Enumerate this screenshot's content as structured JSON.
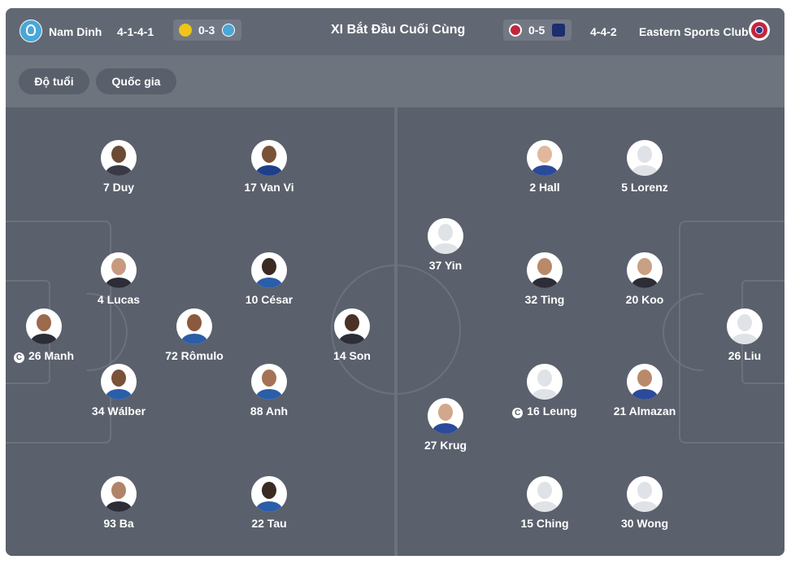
{
  "header": {
    "title": "XI Bắt Đầu Cuối Cùng",
    "home": {
      "name": "Nam Dinh",
      "formation": "4-1-4-1",
      "last_score": "0-3",
      "logo_icon": "nam-dinh-crest"
    },
    "away": {
      "name": "Eastern Sports Club",
      "formation": "4-4-2",
      "last_score": "0-5",
      "logo_icon": "eastern-sc-crest"
    }
  },
  "tabs": [
    {
      "label": "Độ tuổi",
      "active": false
    },
    {
      "label": "Quốc gia",
      "active": true
    }
  ],
  "home_players": [
    {
      "label": "7 Duy",
      "avatar": "photo"
    },
    {
      "label": "17 Van Vi",
      "avatar": "photo"
    },
    {
      "label": "4 Lucas",
      "avatar": "photo"
    },
    {
      "label": "10 César",
      "avatar": "photo"
    },
    {
      "label": "26 Manh",
      "avatar": "photo",
      "captain": true
    },
    {
      "label": "72 Rômulo",
      "avatar": "photo"
    },
    {
      "label": "14 Son",
      "avatar": "photo"
    },
    {
      "label": "34 Wálber",
      "avatar": "photo"
    },
    {
      "label": "88 Anh",
      "avatar": "photo"
    },
    {
      "label": "93 Ba",
      "avatar": "photo"
    },
    {
      "label": "22 Tau",
      "avatar": "photo"
    }
  ],
  "away_players": [
    {
      "label": "2 Hall",
      "avatar": "photo"
    },
    {
      "label": "5 Lorenz",
      "avatar": "placeholder"
    },
    {
      "label": "37 Yin",
      "avatar": "placeholder"
    },
    {
      "label": "32 Ting",
      "avatar": "photo"
    },
    {
      "label": "20 Koo",
      "avatar": "photo"
    },
    {
      "label": "26 Liu",
      "avatar": "placeholder"
    },
    {
      "label": "16 Leung",
      "avatar": "placeholder",
      "captain": true
    },
    {
      "label": "21 Almazan",
      "avatar": "photo"
    },
    {
      "label": "27 Krug",
      "avatar": "photo"
    },
    {
      "label": "15 Ching",
      "avatar": "placeholder"
    },
    {
      "label": "30 Wong",
      "avatar": "placeholder"
    }
  ],
  "captain_mark": "C",
  "colors": {
    "pitch": "#5a606c",
    "header": "#626873",
    "tabs_bar": "#6e747e",
    "lines": "#6c727d"
  }
}
